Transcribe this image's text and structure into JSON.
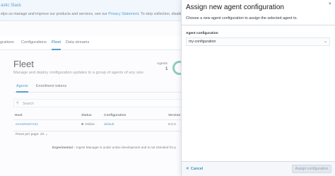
{
  "banner": {
    "title": "astic Stack",
    "text_before_link": "elps us manage and improve our products and services, see our",
    "link": "Privacy Statement",
    "text_after_link": ". To stop collection, disable us"
  },
  "nav_tabs": [
    {
      "label": "grations"
    },
    {
      "label": "Configurations"
    },
    {
      "label": "Fleet"
    },
    {
      "label": "Data streams"
    }
  ],
  "fleet": {
    "title": "Fleet",
    "description": "Manage and deploy configuration updates to a group of agents of any size.",
    "agents_label": "Agents",
    "agents_count": "1"
  },
  "subtabs": [
    {
      "label": "Agents"
    },
    {
      "label": "Enrollment tokens"
    }
  ],
  "search": {
    "placeholder": "Search"
  },
  "table": {
    "headers": {
      "host": "Host",
      "status": "Status",
      "configuration": "Configuration",
      "version": "Version"
    },
    "rows": [
      {
        "host": "ee1925337431",
        "status": "Online",
        "configuration": "default",
        "version": "8.0.0"
      }
    ]
  },
  "rows_per_page": "Rows per page: 20",
  "footer": {
    "bold": "Experimental",
    "text": " – Ingest Manager is under active development and is not intended for p"
  },
  "flyout": {
    "title": "Assign new agent configuration",
    "close": "×",
    "description": "Choose a new agent configuration to assign the selected agent to.",
    "field_label": "Agent configuration",
    "selected": "my-configuration",
    "cancel_label": "Cancel",
    "assign_label": "Assign configuration"
  }
}
